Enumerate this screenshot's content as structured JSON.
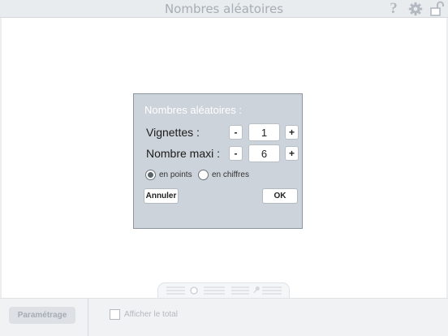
{
  "app": {
    "title": "Nombres aléatoires"
  },
  "toolbar": {
    "help_icon": "?"
  },
  "dialog": {
    "title": "Nombres aléatoires :",
    "rows": [
      {
        "label": "Vignettes :",
        "minus": "-",
        "value": "1",
        "plus": "+"
      },
      {
        "label": "Nombre maxi :",
        "minus": "-",
        "value": "6",
        "plus": "+"
      }
    ],
    "mode": {
      "options": [
        "en points",
        "en chiffres"
      ],
      "selected": "en points"
    },
    "cancel_label": "Annuler",
    "ok_label": "OK"
  },
  "bottombar": {
    "param_label": "Paramétrage",
    "total_label": "Afficher le total",
    "total_checked": false
  },
  "icons": [
    "help-icon",
    "gear-icon",
    "lock-icon",
    "dots-icon",
    "pin-icon"
  ]
}
